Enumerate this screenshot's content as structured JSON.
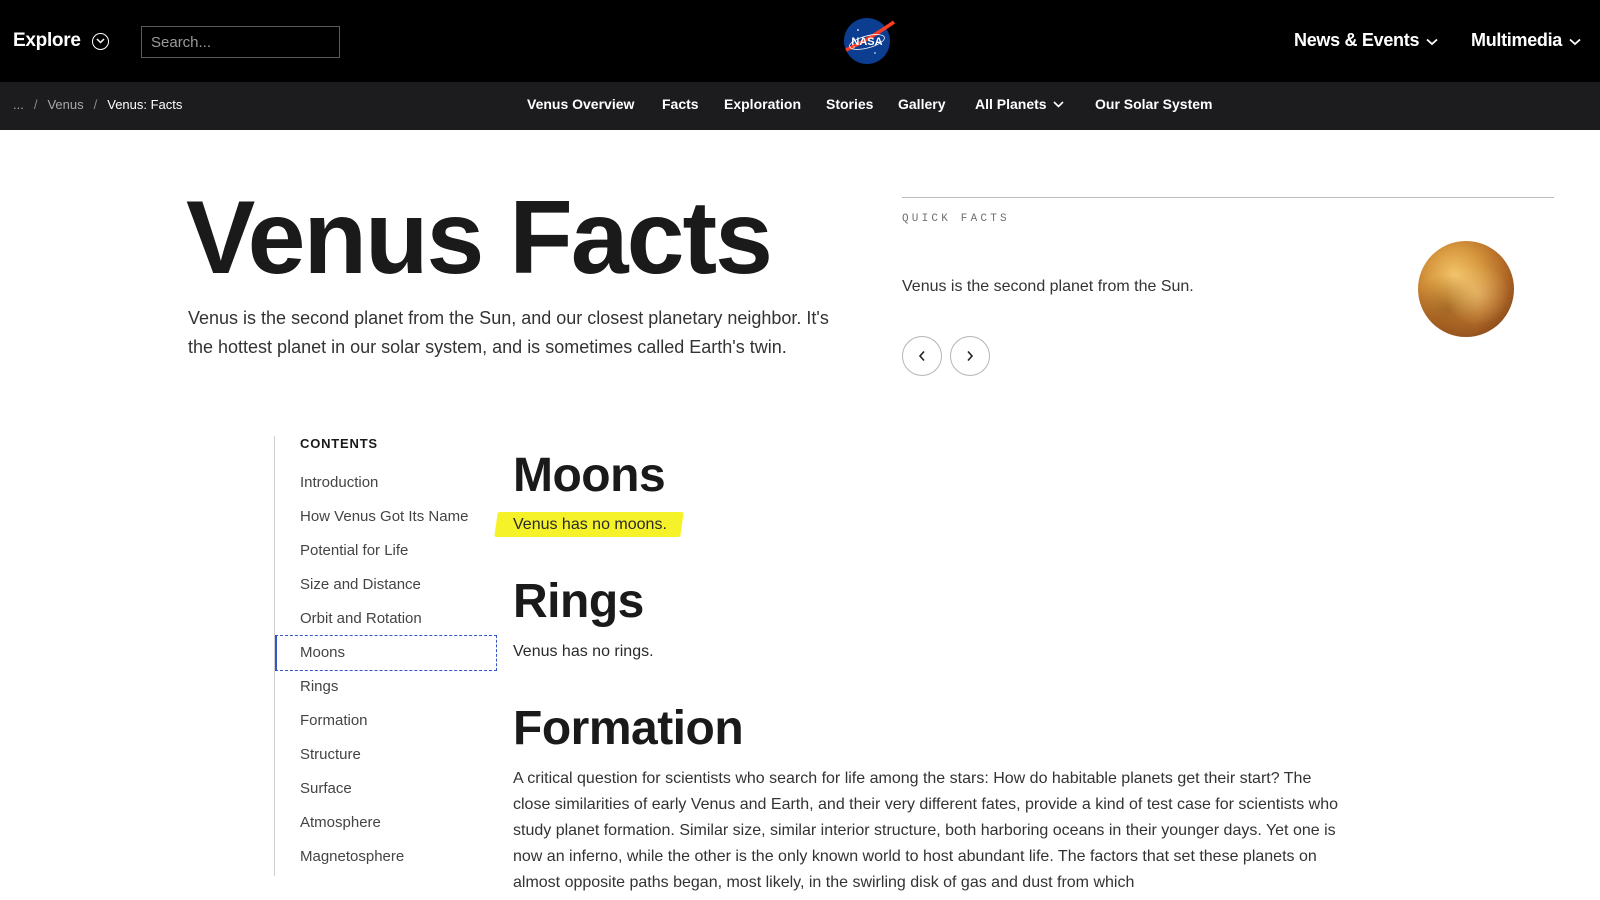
{
  "header": {
    "explore_label": "Explore",
    "search_placeholder": "Search...",
    "logo_text": "NASA",
    "nav": [
      "News & Events",
      "Multimedia"
    ]
  },
  "subnav": {
    "breadcrumb": [
      "...",
      "Venus",
      "Venus: Facts"
    ],
    "items": [
      "Venus Overview",
      "Facts",
      "Exploration",
      "Stories",
      "Gallery",
      "All Planets",
      "Our Solar System"
    ]
  },
  "hero": {
    "title": "Venus Facts",
    "description": "Venus is the second planet from the Sun, and our closest planetary neighbor. It's the hottest planet in our solar system, and is sometimes called Earth's twin."
  },
  "quick_facts": {
    "label": "QUICK FACTS",
    "text": "Venus is the second planet from the Sun."
  },
  "contents": {
    "heading": "CONTENTS",
    "items": [
      "Introduction",
      "How Venus Got Its Name",
      "Potential for Life",
      "Size and Distance",
      "Orbit and Rotation",
      "Moons",
      "Rings",
      "Formation",
      "Structure",
      "Surface",
      "Atmosphere",
      "Magnetosphere"
    ],
    "active": "Moons"
  },
  "article": {
    "moons_heading": "Moons",
    "moons_text": "Venus has no moons.",
    "rings_heading": "Rings",
    "rings_text": "Venus has no rings.",
    "formation_heading": "Formation",
    "formation_text": "A critical question for scientists who search for life among the stars: How do habitable planets get their start? The close similarities of early Venus and Earth, and their very different fates, provide a kind of test case for scientists who study planet formation. Similar size, similar interior structure, both harboring oceans in their younger days. Yet one is now an inferno, while the other is the only known world to host abundant life. The factors that set these planets on almost opposite paths began, most likely, in the swirling disk of gas and dust from which"
  },
  "colors": {
    "topbar": "#000000",
    "subbar": "#1c1c1e",
    "highlight": "#f6f22a",
    "active_border": "#3358c4",
    "nasa_blue": "#0b3d91",
    "nasa_red": "#fc3d21"
  }
}
